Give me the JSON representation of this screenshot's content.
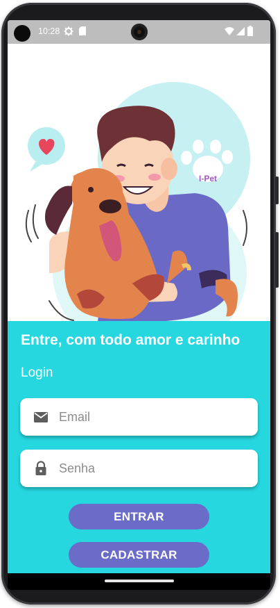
{
  "status_bar": {
    "time": "10:28",
    "icons": [
      "gear-icon",
      "sd-card-icon",
      "wifi-icon",
      "signal-icon",
      "battery-icon"
    ]
  },
  "hero": {
    "description_icon": "man-hugging-dog-illustration",
    "badge_text": "I-Pet",
    "heart_icon": "heart-icon",
    "paw_icon": "paw-icon"
  },
  "login": {
    "headline": "Entre, com todo amor e carinho",
    "section_label": "Login",
    "email": {
      "placeholder": "Email",
      "value": "",
      "icon": "envelope-icon"
    },
    "password": {
      "placeholder": "Senha",
      "value": "",
      "icon": "lock-icon"
    },
    "login_button": "ENTRAR",
    "register_button": "CADASTRAR"
  },
  "colors": {
    "panel": "#26d7df",
    "button": "#6b6bc8",
    "status_bar": "#bdbdbd",
    "text_light": "#ffffff"
  }
}
